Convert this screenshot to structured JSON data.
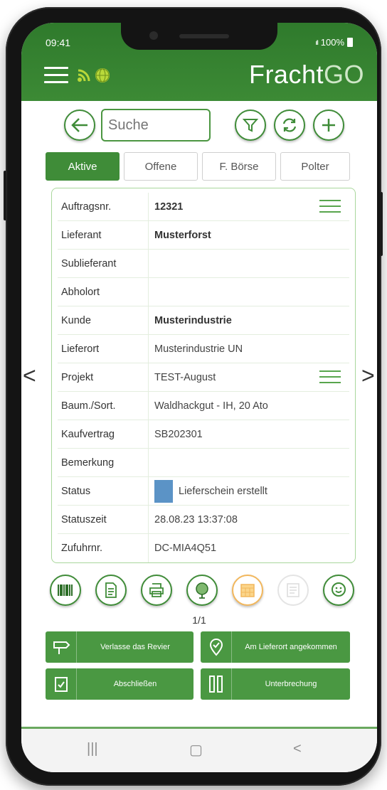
{
  "status_bar": {
    "time": "09:41",
    "signal": "ıll",
    "battery": "100%"
  },
  "header": {
    "logo_main": "Fracht",
    "logo_accent": "GO"
  },
  "search": {
    "placeholder": "Suche"
  },
  "tabs": [
    {
      "label": "Aktive",
      "active": true
    },
    {
      "label": "Offene",
      "active": false
    },
    {
      "label": "F. Börse",
      "active": false
    },
    {
      "label": "Polter",
      "active": false
    }
  ],
  "details": {
    "auftragsnr": {
      "label": "Auftragsnr.",
      "value": "12321"
    },
    "lieferant": {
      "label": "Lieferant",
      "value": "Musterforst"
    },
    "sublieferant": {
      "label": "Sublieferant",
      "value": ""
    },
    "abholort": {
      "label": "Abholort",
      "value": ""
    },
    "kunde": {
      "label": "Kunde",
      "value": "Musterindustrie"
    },
    "lieferort": {
      "label": "Lieferort",
      "value": "Musterindustrie UN"
    },
    "projekt": {
      "label": "Projekt",
      "value": "TEST-August"
    },
    "baum_sort": {
      "label": "Baum./Sort.",
      "value": "Waldhackgut - IH, 20 Ato"
    },
    "kaufvertrag": {
      "label": "Kaufvertrag",
      "value": "SB202301"
    },
    "bemerkung": {
      "label": "Bemerkung",
      "value": ""
    },
    "status": {
      "label": "Status",
      "value": "Lieferschein erstellt",
      "color": "#5b93c6"
    },
    "statuszeit": {
      "label": "Statuszeit",
      "value": "28.08.23 13:37:08"
    },
    "zufuhrnr": {
      "label": "Zufuhrnr.",
      "value": "DC-MIA4Q51"
    }
  },
  "nav": {
    "prev": "<",
    "next": ">"
  },
  "pager": "1/1",
  "actions": {
    "leave_area": "Verlasse das Revier",
    "arrived": "Am Lieferort angekommen",
    "finish": "Abschließen",
    "interrupt": "Unterbrechung"
  },
  "system_nav": {
    "recents": "|||",
    "home": "▢",
    "back": "<"
  },
  "colors": {
    "brand_green": "#3f8c38",
    "light_green": "#a9d79c",
    "status_blue": "#5b93c6",
    "orange": "#f2b75c"
  }
}
